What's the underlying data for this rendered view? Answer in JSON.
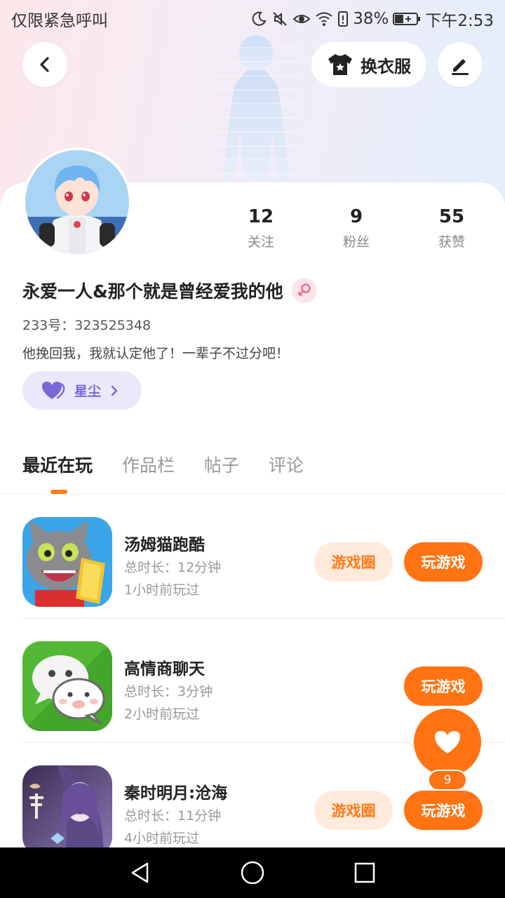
{
  "status_bar": {
    "carrier_text": "仅限紧急呼叫",
    "battery": "38%",
    "time": "下午2:53"
  },
  "header": {
    "outfit_label": "换衣服"
  },
  "profile": {
    "stats": [
      {
        "value": "12",
        "label": "关注"
      },
      {
        "value": "9",
        "label": "粉丝"
      },
      {
        "value": "55",
        "label": "获赞"
      }
    ],
    "username": "永爱一人&那个就是曾经爱我的他",
    "gender": "female",
    "user_id": "233号：323525348",
    "bio": "他挽回我，我就认定他了！一辈子不过分吧！",
    "stardust_label": "星尘"
  },
  "tabs": [
    {
      "label": "最近在玩",
      "active": true
    },
    {
      "label": "作品栏",
      "active": false
    },
    {
      "label": "帖子",
      "active": false
    },
    {
      "label": "评论",
      "active": false
    }
  ],
  "games": [
    {
      "name": "汤姆猫跑酷",
      "duration": "总时长：12分钟",
      "last_played": "1小时前玩过",
      "has_circle": true
    },
    {
      "name": "高情商聊天",
      "duration": "总时长：3分钟",
      "last_played": "2小时前玩过",
      "has_circle": false
    },
    {
      "name": "秦时明月:沧海",
      "duration": "总时长：11分钟",
      "last_played": "4小时前玩过",
      "has_circle": true
    }
  ],
  "buttons": {
    "game_circle": "游戏圈",
    "play": "玩游戏"
  },
  "fab": {
    "like_count": "9"
  },
  "colors": {
    "accent": "#ff7312",
    "accent_light": "#ffeadb",
    "stardust_bg": "#ece8fb",
    "stardust_text": "#7a67d8"
  }
}
